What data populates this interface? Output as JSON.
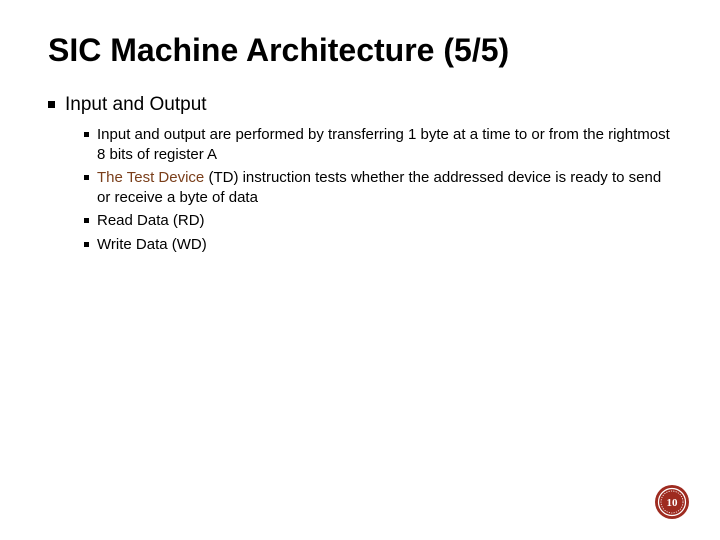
{
  "title": "SIC Machine Architecture (5/5)",
  "section": "Input and Output",
  "items": {
    "a_pre": "Input and output are performed by transferring 1 byte at a time to or from the rightmost 8 bits of register A",
    "b_accent": "The Test Device",
    "b_post": " (TD) instruction tests whether the addressed device is ready to send or receive a byte of data",
    "c": "Read Data (RD)",
    "d": "Write Data (WD)"
  },
  "page_number": "10"
}
